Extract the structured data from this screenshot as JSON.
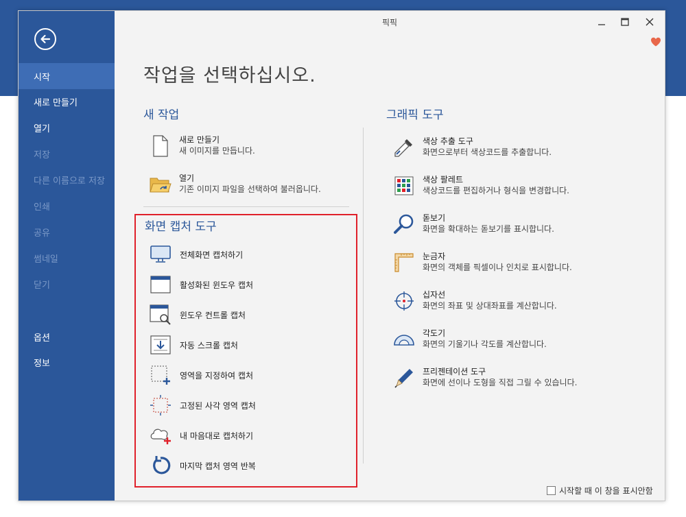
{
  "window": {
    "title": "픽픽"
  },
  "sidebar": {
    "items": [
      {
        "label": "시작",
        "state": "active"
      },
      {
        "label": "새로 만들기",
        "state": "normal"
      },
      {
        "label": "열기",
        "state": "normal"
      },
      {
        "label": "저장",
        "state": "disabled"
      },
      {
        "label": "다른 이름으로 저장",
        "state": "disabled"
      },
      {
        "label": "인쇄",
        "state": "disabled"
      },
      {
        "label": "공유",
        "state": "disabled"
      },
      {
        "label": "썸네일",
        "state": "disabled"
      },
      {
        "label": "닫기",
        "state": "disabled"
      },
      {
        "label": "옵션",
        "state": "normal"
      },
      {
        "label": "정보",
        "state": "normal"
      }
    ]
  },
  "main": {
    "title": "작업을 선택하십시오.",
    "new_task": {
      "title": "새 작업",
      "items": [
        {
          "icon": "new-document-icon",
          "title": "새로 만들기",
          "desc": "새 이미지를 만듭니다."
        },
        {
          "icon": "open-folder-icon",
          "title": "열기",
          "desc": "기존 이미지 파일을 선택하여 불러옵니다."
        }
      ]
    },
    "capture": {
      "title": "화면 캡처 도구",
      "items": [
        {
          "icon": "monitor-icon",
          "label": "전체화면 캡처하기"
        },
        {
          "icon": "active-window-icon",
          "label": "활성화된 윈도우 캡처"
        },
        {
          "icon": "window-control-icon",
          "label": "윈도우 컨트롤 캡처"
        },
        {
          "icon": "scroll-capture-icon",
          "label": "자동 스크롤 캡처"
        },
        {
          "icon": "region-select-icon",
          "label": "영역을 지정하여 캡처"
        },
        {
          "icon": "fixed-region-icon",
          "label": "고정된 사각 영역 캡처"
        },
        {
          "icon": "freehand-capture-icon",
          "label": "내 마음대로 캡처하기"
        },
        {
          "icon": "repeat-capture-icon",
          "label": "마지막 캡처 영역 반복"
        }
      ]
    },
    "graphics": {
      "title": "그래픽 도구",
      "items": [
        {
          "icon": "eyedropper-icon",
          "title": "색상 추출 도구",
          "desc": "화면으로부터 색상코드를 추출합니다."
        },
        {
          "icon": "color-palette-icon",
          "title": "색상 팔레트",
          "desc": "색상코드를 편집하거나 형식을 변경합니다."
        },
        {
          "icon": "magnifier-icon",
          "title": "돋보기",
          "desc": "화면을 확대하는 돋보기를 표시합니다."
        },
        {
          "icon": "ruler-icon",
          "title": "눈금자",
          "desc": "화면의 객체를 픽셀이나 인치로 표시합니다."
        },
        {
          "icon": "crosshair-icon",
          "title": "십자선",
          "desc": "화면의 좌표 및 상대좌표를 계산합니다."
        },
        {
          "icon": "protractor-icon",
          "title": "각도기",
          "desc": "화면의 기울기나 각도를 계산합니다."
        },
        {
          "icon": "pen-icon",
          "title": "프리젠테이션 도구",
          "desc": "화면에 선이나 도형을 직접 그릴 수 있습니다."
        }
      ]
    }
  },
  "footer": {
    "checkbox_label": "시작할 때 이 창을 표시안함",
    "checked": false
  },
  "colors": {
    "accent": "#2b579a",
    "highlight_border": "#e0202a",
    "heart": "#e8674a"
  }
}
